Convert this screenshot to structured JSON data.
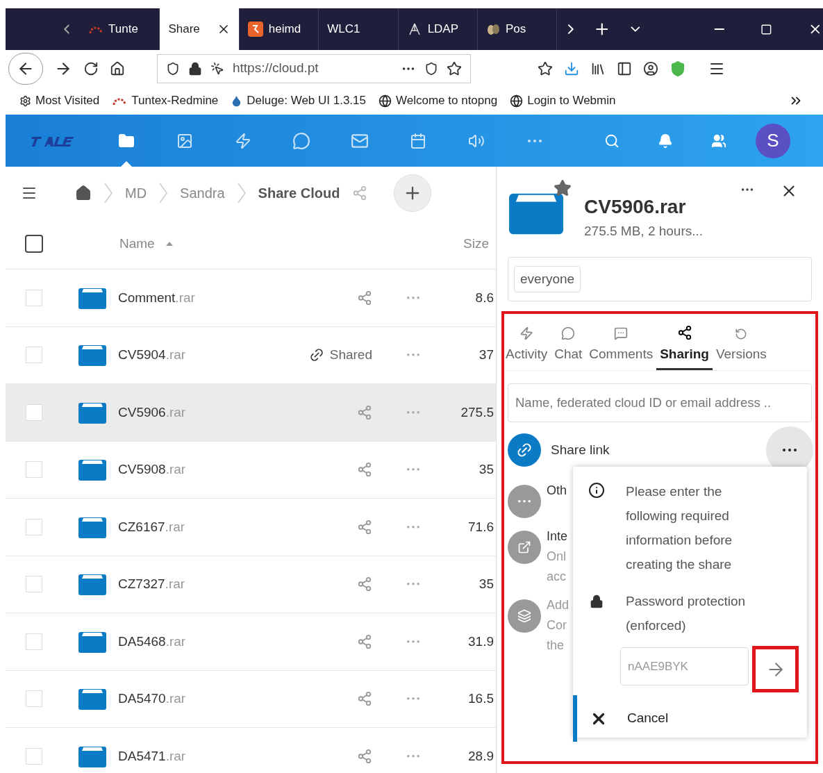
{
  "browser": {
    "tabs": [
      {
        "label": "Tunte",
        "selected": false
      },
      {
        "label": "Share",
        "selected": true
      },
      {
        "label": "heimd",
        "selected": false
      },
      {
        "label": "WLC1",
        "selected": false
      },
      {
        "label": "LDAP",
        "selected": false
      },
      {
        "label": "Pos",
        "selected": false
      }
    ],
    "url": "https://cloud.pt",
    "bookmarks": [
      {
        "label": "Most Visited"
      },
      {
        "label": "Tuntex-Redmine"
      },
      {
        "label": "Deluge: Web UI 1.3.15"
      },
      {
        "label": "Welcome to ntopng"
      },
      {
        "label": "Login to Webmin"
      }
    ]
  },
  "app": {
    "nav": [
      {
        "kind": "files",
        "selected": true
      },
      {
        "kind": "photos",
        "selected": false
      },
      {
        "kind": "activity",
        "selected": false
      },
      {
        "kind": "chat",
        "selected": false
      },
      {
        "kind": "mail",
        "selected": false
      },
      {
        "kind": "calendar",
        "selected": false
      },
      {
        "kind": "audio",
        "selected": false
      },
      {
        "kind": "more",
        "selected": false
      }
    ],
    "avatar": "S",
    "breadcrumbs": [
      {
        "label": "MD",
        "current": false
      },
      {
        "label": "Sandra",
        "current": false
      },
      {
        "label": "Share Cloud",
        "current": true
      }
    ],
    "columns": {
      "name": "Name",
      "size": "Size"
    },
    "select_all": {
      "checked": false
    },
    "rows": [
      {
        "name": "Comment",
        "ext": ".rar",
        "shared": false,
        "size": "8.6",
        "selected": false
      },
      {
        "name": "CV5904",
        "ext": ".rar",
        "shared": true,
        "shared_label": "Shared",
        "size": "37",
        "selected": false
      },
      {
        "name": "CV5906",
        "ext": ".rar",
        "shared": false,
        "size": "275.5",
        "selected": true
      },
      {
        "name": "CV5908",
        "ext": ".rar",
        "shared": false,
        "size": "35",
        "selected": false
      },
      {
        "name": "CZ6167",
        "ext": ".rar",
        "shared": false,
        "size": "71.6",
        "selected": false
      },
      {
        "name": "CZ7327",
        "ext": ".rar",
        "shared": false,
        "size": "35",
        "selected": false
      },
      {
        "name": "DA5468",
        "ext": ".rar",
        "shared": false,
        "size": "31.9",
        "selected": false
      },
      {
        "name": "DA5470",
        "ext": ".rar",
        "shared": false,
        "size": "16.5",
        "selected": false
      },
      {
        "name": "DA5471",
        "ext": ".rar",
        "shared": false,
        "size": "28.9",
        "selected": false
      }
    ]
  },
  "details": {
    "title": "CV5906.rar",
    "meta": "275.5 MB, 2 hours...",
    "favorite": true,
    "tags": [
      "everyone"
    ],
    "tabs": [
      {
        "label": "Activity",
        "kind": "activity",
        "selected": false
      },
      {
        "label": "Chat",
        "kind": "chat",
        "selected": false
      },
      {
        "label": "Comments",
        "kind": "comments",
        "selected": false
      },
      {
        "label": "Sharing",
        "kind": "sharing",
        "selected": true
      },
      {
        "label": "Versions",
        "kind": "versions",
        "selected": false
      }
    ],
    "search_placeholder": "Name, federated cloud ID or email address ..",
    "share_link": "Share link",
    "entries": [
      {
        "kind": "other",
        "lines": [
          "Oth"
        ]
      },
      {
        "kind": "internal",
        "lines": [
          "Inte",
          "Onl",
          "acc"
        ]
      },
      {
        "kind": "circle",
        "lines": [
          "Add",
          "Cor",
          "the"
        ]
      }
    ],
    "popup": {
      "info": "Please enter the following required information before creating the share",
      "password_label": "Password protection",
      "password_note": "(enforced)",
      "password": "nAAE9BYK",
      "cancel": "Cancel"
    }
  }
}
